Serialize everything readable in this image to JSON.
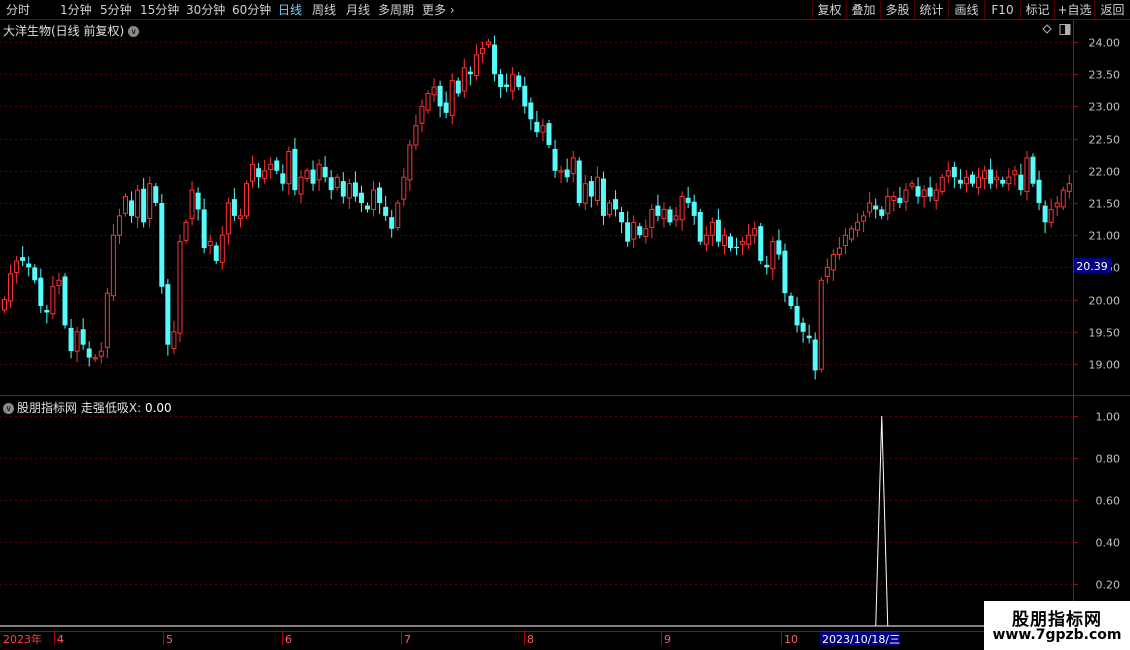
{
  "toolbar": {
    "periods": [
      "分时",
      "1分钟",
      "5分钟",
      "15分钟",
      "30分钟",
      "60分钟",
      "日线",
      "周线",
      "月线",
      "多周期",
      "更多"
    ],
    "active_period": "日线",
    "right_buttons": [
      "复权",
      "叠加",
      "多股",
      "统计",
      "画线",
      "F10",
      "标记",
      "+自选",
      "返回"
    ]
  },
  "main_chart": {
    "title": "大洋生物(日线 前复权)",
    "price_tag": "20.39"
  },
  "indicator": {
    "name": "股朋指标网",
    "label": "走强低吸X:",
    "value": "0.00"
  },
  "bottom_axis": {
    "year_label": "2023年",
    "month_labels": [
      "4",
      "5",
      "6",
      "7",
      "8",
      "9",
      "10"
    ],
    "cursor_date": "2023/10/18/三"
  },
  "watermark": {
    "name": "股朋指标网",
    "url": "www.7gpzb.com"
  },
  "colors": {
    "up": "#ff3232",
    "down": "#54fcfc",
    "axis": "#b40000",
    "grid": "#5a0000",
    "active": "#6fd3ff",
    "price_tag_bg": "#000080"
  },
  "chart_data": [
    {
      "type": "candlestick",
      "title": "大洋生物(日线 前复权)",
      "y_ticks": [
        19.0,
        19.5,
        20.0,
        20.5,
        21.0,
        21.5,
        22.0,
        22.5,
        23.0,
        23.5,
        24.0
      ],
      "ylim": [
        18.85,
        24.05
      ],
      "grid": true,
      "approx_closes": [
        20.0,
        20.4,
        20.6,
        20.6,
        20.5,
        20.3,
        19.9,
        19.8,
        20.2,
        20.3,
        19.6,
        19.2,
        19.5,
        19.3,
        19.1,
        19.1,
        19.2,
        20.1,
        21.0,
        21.3,
        21.6,
        21.3,
        21.7,
        21.2,
        21.8,
        21.5,
        20.2,
        19.3,
        19.5,
        20.9,
        21.2,
        21.7,
        21.4,
        20.8,
        20.9,
        20.6,
        21.0,
        21.5,
        21.3,
        21.3,
        21.8,
        22.1,
        21.9,
        22.0,
        22.1,
        22.0,
        21.8,
        22.3,
        21.7,
        21.9,
        22.0,
        21.8,
        22.1,
        21.9,
        21.7,
        21.9,
        21.6,
        21.8,
        21.6,
        21.5,
        21.4,
        21.7,
        21.5,
        21.3,
        21.1,
        21.5,
        21.9,
        22.4,
        22.7,
        23.0,
        23.2,
        23.3,
        23.0,
        22.9,
        23.4,
        23.2,
        23.6,
        23.5,
        23.8,
        23.9,
        24.0,
        23.5,
        23.3,
        23.3,
        23.5,
        23.3,
        23.0,
        22.8,
        22.6,
        22.7,
        22.4,
        22.0,
        22.0,
        21.9,
        22.2,
        21.5,
        21.8,
        21.6,
        21.9,
        21.3,
        21.5,
        21.4,
        21.2,
        20.9,
        21.2,
        21.0,
        21.1,
        21.4,
        21.3,
        21.4,
        21.2,
        21.3,
        21.6,
        21.5,
        21.3,
        20.9,
        21.0,
        21.2,
        20.9,
        21.0,
        20.8,
        20.8,
        20.9,
        21.0,
        21.1,
        20.6,
        20.5,
        20.9,
        20.7,
        20.1,
        19.9,
        19.6,
        19.5,
        19.4,
        18.9,
        20.3,
        20.5,
        20.7,
        20.8,
        21.0,
        21.1,
        21.2,
        21.3,
        21.5,
        21.4,
        21.3,
        21.6,
        21.6,
        21.5,
        21.7,
        21.8,
        21.6,
        21.7,
        21.6,
        21.7,
        21.9,
        22.0,
        21.9,
        21.8,
        21.9,
        21.8,
        21.9,
        22.0,
        21.8,
        21.9,
        21.8,
        21.9,
        22.0,
        21.7,
        22.2,
        21.8,
        21.5,
        21.2,
        21.4,
        21.5,
        21.7,
        21.8
      ]
    },
    {
      "type": "line",
      "title": "走强低吸X",
      "y_ticks": [
        0.2,
        0.4,
        0.6,
        0.8,
        1.0
      ],
      "ylim": [
        0,
        1.05
      ],
      "signal_index": 145,
      "signal_value": 1.0,
      "x_label_positions": [
        "2023年",
        "4",
        "5",
        "6",
        "7",
        "8",
        "9",
        "10"
      ]
    }
  ]
}
